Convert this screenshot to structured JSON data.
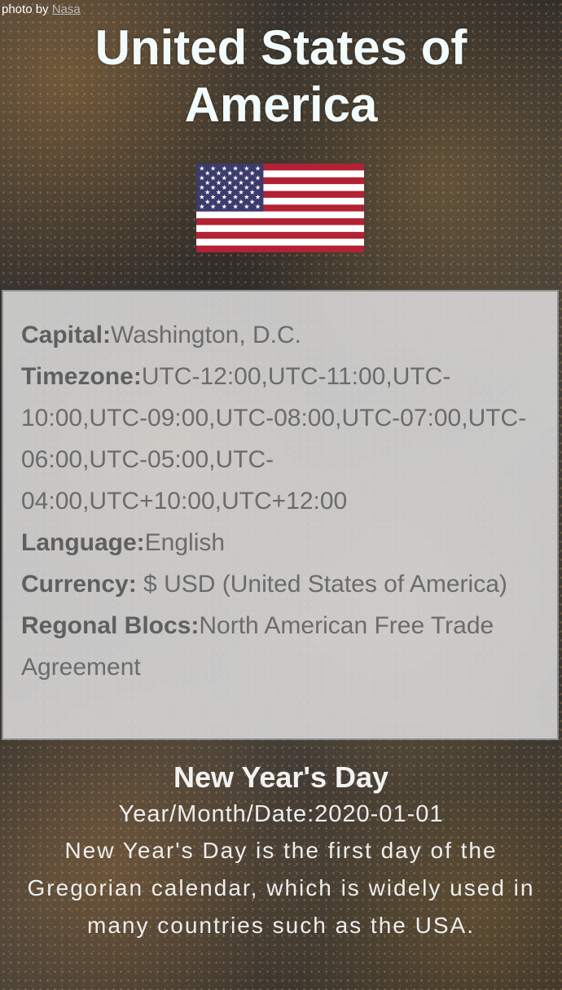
{
  "credit": {
    "prefix": "photo by ",
    "author": "Nasa"
  },
  "country": {
    "name": "United States of America"
  },
  "flag": {
    "icon": "us-flag-icon",
    "colors": {
      "red": "#b22234",
      "white": "#ffffff",
      "blue": "#3c3b6e"
    }
  },
  "info": {
    "capital_label": "Capital:",
    "capital": "Washington, D.C.",
    "timezone_label": "Timezone:",
    "timezone": "UTC-12:00,UTC-11:00,UTC-10:00,UTC-09:00,UTC-08:00,UTC-07:00,UTC-06:00,UTC-05:00,UTC-04:00,UTC+10:00,UTC+12:00",
    "language_label": "Language:",
    "language": "English",
    "currency_label": "Currency:",
    "currency": " $ USD (United States of America)",
    "blocs_label": "Regonal Blocs:",
    "blocs": "North American Free Trade Agreement"
  },
  "holiday": {
    "name": "New Year's Day",
    "date_label": "Year/Month/Date:",
    "date": "2020-01-01",
    "description": "New Year's Day is the first day of the Gregorian calendar, which is widely used in many countries such as the USA."
  }
}
